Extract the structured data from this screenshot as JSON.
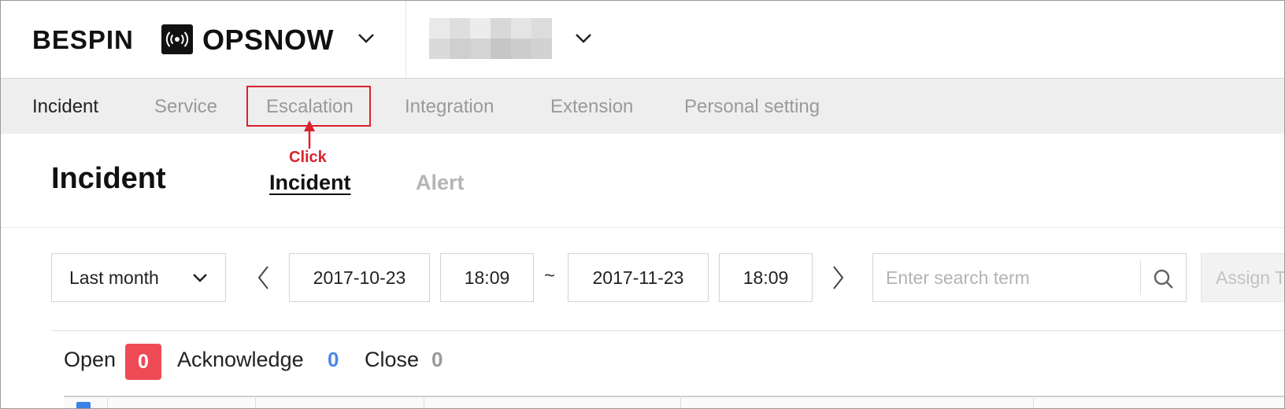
{
  "header": {
    "brand": "BESPIN",
    "product": "OPSNOW"
  },
  "nav": {
    "items": [
      {
        "label": "Incident"
      },
      {
        "label": "Service"
      },
      {
        "label": "Escalation"
      },
      {
        "label": "Integration"
      },
      {
        "label": "Extension"
      },
      {
        "label": "Personal setting"
      }
    ]
  },
  "annotation": {
    "click_label": "Click",
    "color": "#d9232e"
  },
  "page": {
    "title": "Incident",
    "tabs": [
      {
        "label": "Incident"
      },
      {
        "label": "Alert"
      }
    ]
  },
  "filters": {
    "period": "Last month",
    "start_date": "2017-10-23",
    "start_time": "18:09",
    "separator": "~",
    "end_date": "2017-11-23",
    "end_time": "18:09",
    "search_placeholder": "Enter search term",
    "assign_label": "Assign T"
  },
  "status": {
    "open_label": "Open",
    "open_count": "0",
    "acknowledge_label": "Acknowledge",
    "acknowledge_count": "0",
    "close_label": "Close",
    "close_count": "0",
    "colors": {
      "open": "#ee4b57",
      "acknowledge": "#4a86e8",
      "close": "#9a9a9a"
    }
  },
  "icons": [
    "broadcast-icon",
    "chevron-down-icon",
    "chevron-left-icon",
    "chevron-right-icon",
    "search-icon",
    "arrow-up-icon"
  ]
}
